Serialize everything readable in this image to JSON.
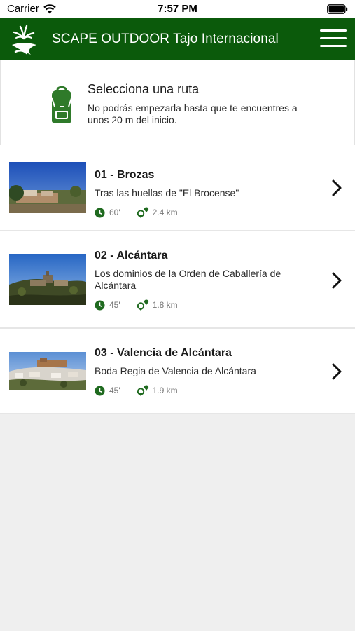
{
  "status_bar": {
    "carrier": "Carrier",
    "time": "7:57 PM"
  },
  "header": {
    "title": "SCAPE OUTDOOR Tajo Internacional",
    "brand_color": "#0b5a0b"
  },
  "info": {
    "title": "Selecciona una ruta",
    "text": "No podrás empezarla hasta que te encuentres a unos 20 m del inicio."
  },
  "routes": [
    {
      "name": "01 - Brozas",
      "description": "Tras las huellas de \"El Brocense\"",
      "duration": "60'",
      "distance": "2.4 km"
    },
    {
      "name": "02 - Alcántara",
      "description": "Los dominios de la Orden de Caballería de Alcántara",
      "duration": "45'",
      "distance": "1.8 km"
    },
    {
      "name": "03 - Valencia de Alcántara",
      "description": "Boda Regia de Valencia de Alcántara",
      "duration": "45'",
      "distance": "1.9 km"
    }
  ]
}
